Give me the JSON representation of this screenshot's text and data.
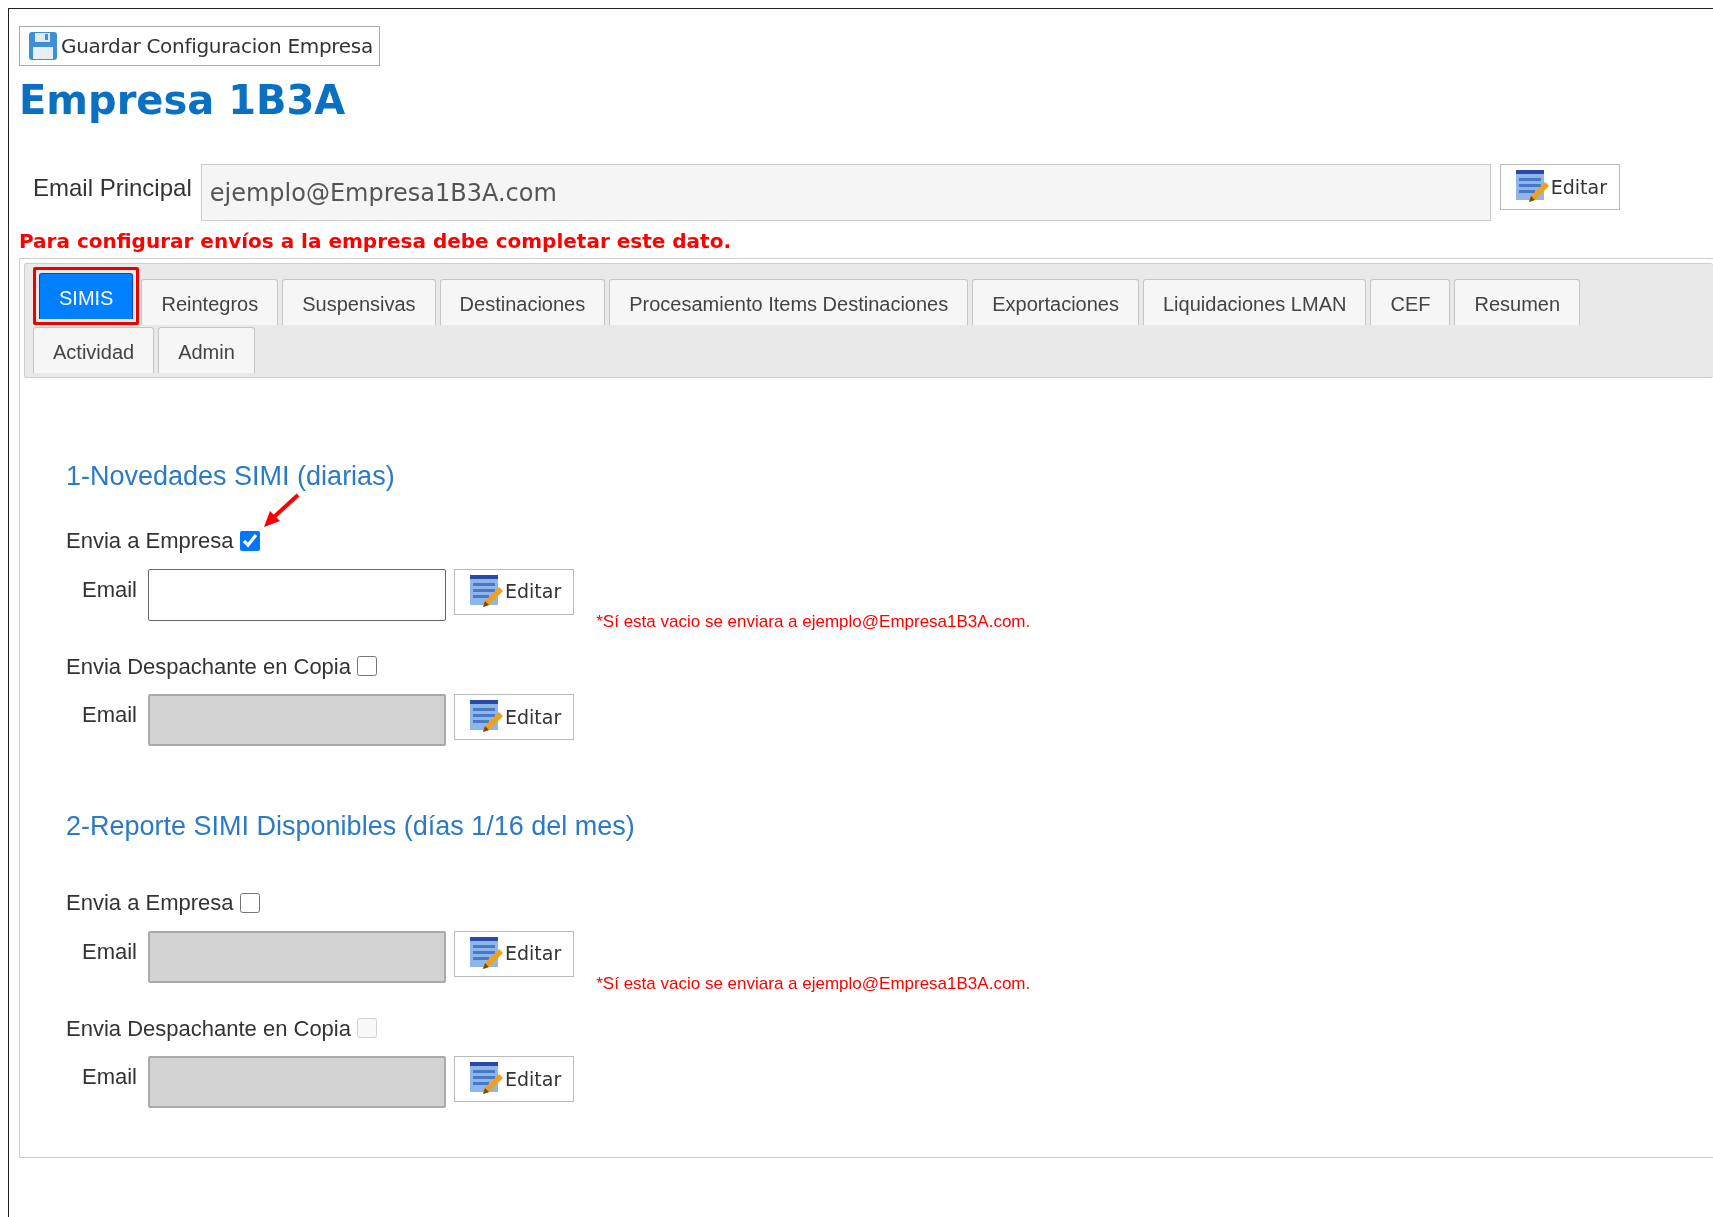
{
  "save_button": {
    "label": "Guardar Configuracion Empresa"
  },
  "title": "Empresa 1B3A",
  "main_email": {
    "label": "Email Principal",
    "value": "ejemplo@Empresa1B3A.com",
    "button": "Editar",
    "warning": "Para configurar envíos a la empresa debe completar este dato."
  },
  "tab_rows": [
    [
      {
        "label": "SIMIS",
        "selected": true,
        "highlighted": true
      },
      {
        "label": "Reintegros",
        "selected": false,
        "highlighted": false
      },
      {
        "label": "Suspensivas",
        "selected": false,
        "highlighted": false
      },
      {
        "label": "Destinaciones",
        "selected": false,
        "highlighted": false
      },
      {
        "label": "Procesamiento Items Destinaciones",
        "selected": false,
        "highlighted": false
      },
      {
        "label": "Exportaciones",
        "selected": false,
        "highlighted": false
      },
      {
        "label": "Liquidaciones LMAN",
        "selected": false,
        "highlighted": false
      },
      {
        "label": "CEF",
        "selected": false,
        "highlighted": false
      },
      {
        "label": "Resumen",
        "selected": false,
        "highlighted": false
      }
    ],
    [
      {
        "label": "Actividad",
        "selected": false,
        "highlighted": false
      },
      {
        "label": "Admin",
        "selected": false,
        "highlighted": false
      }
    ]
  ],
  "sections": [
    {
      "title": "1-Novedades SIMI (diarias)",
      "rows": [
        {
          "kind": "checkbox",
          "label": "Envia a Empresa",
          "checked": true,
          "disabled": false,
          "annotated": true
        },
        {
          "kind": "email",
          "label": "Email",
          "disabled": false,
          "button": "Editar",
          "note": "*Sí esta vacio se enviara a ejemplo@Empresa1B3A.com."
        },
        {
          "kind": "checkbox",
          "label": "Envia Despachante en Copia",
          "checked": false,
          "disabled": false,
          "annotated": false
        },
        {
          "kind": "email",
          "label": "Email",
          "disabled": true,
          "button": "Editar"
        }
      ]
    },
    {
      "title": "2-Reporte SIMI Disponibles (días 1/16 del mes)",
      "rows": [
        {
          "kind": "checkbox",
          "label": "Envia a Empresa",
          "checked": false,
          "disabled": false,
          "annotated": false
        },
        {
          "kind": "email",
          "label": "Email",
          "disabled": true,
          "button": "Editar",
          "note": "*Sí esta vacio se enviara a ejemplo@Empresa1B3A.com."
        },
        {
          "kind": "checkbox",
          "label": "Envia Despachante en Copia",
          "checked": false,
          "disabled": true,
          "annotated": false
        },
        {
          "kind": "email",
          "label": "Email",
          "disabled": true,
          "button": "Editar"
        }
      ]
    }
  ]
}
